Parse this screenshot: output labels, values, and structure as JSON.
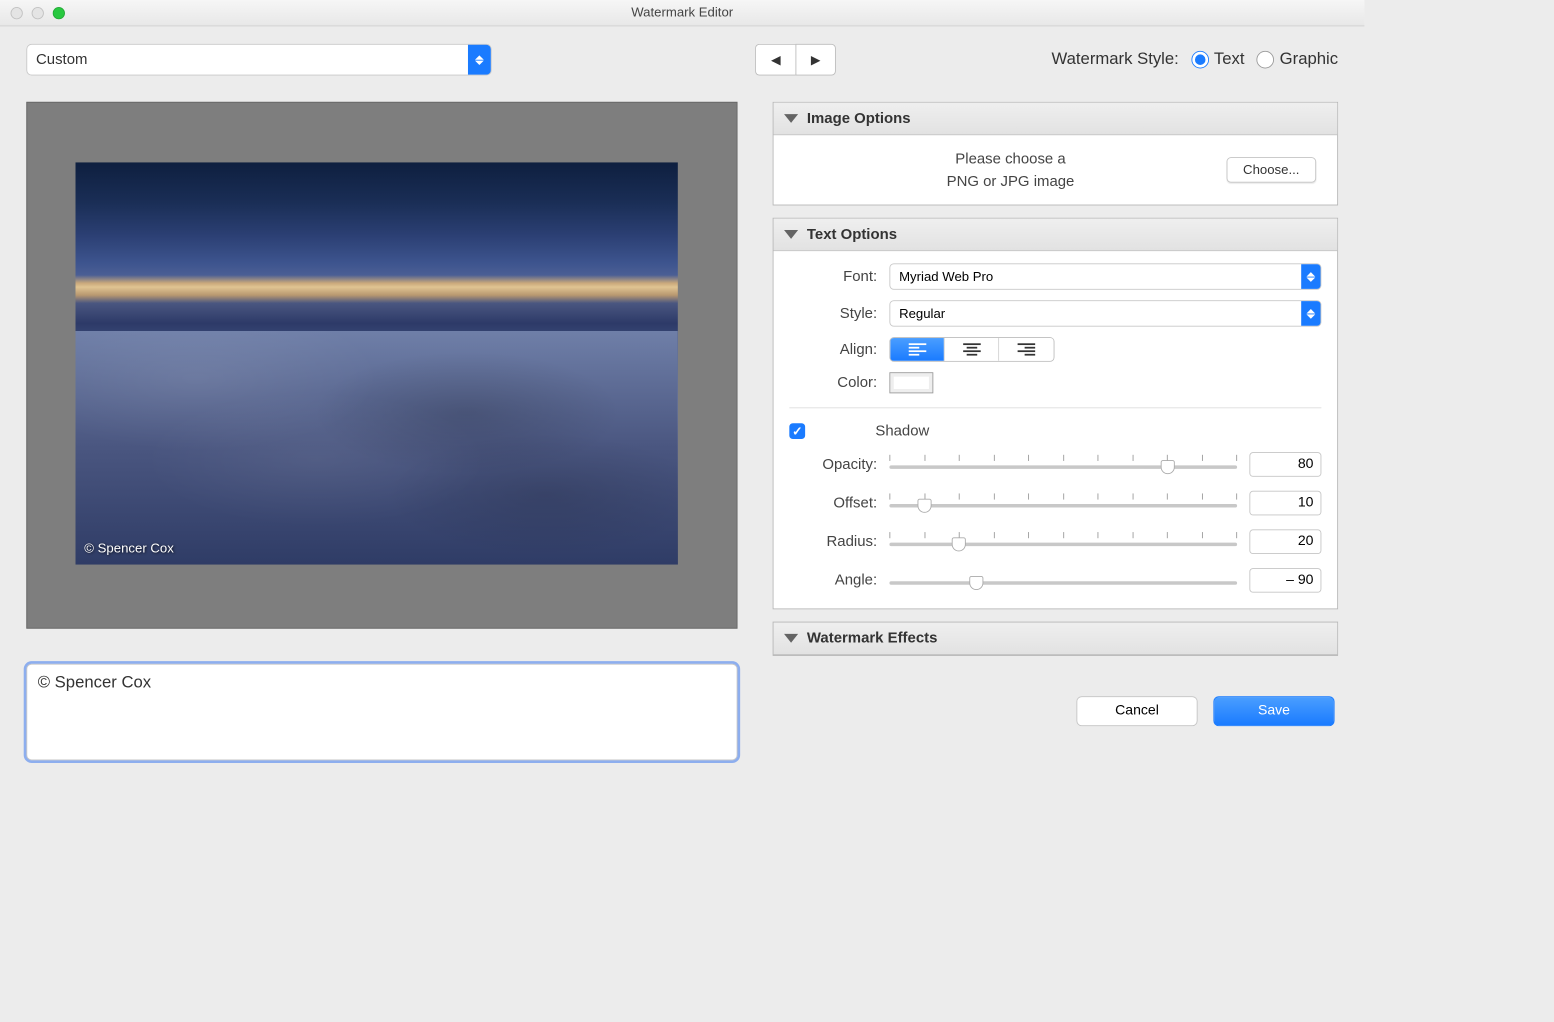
{
  "window": {
    "title": "Watermark Editor"
  },
  "preset": {
    "value": "Custom"
  },
  "style": {
    "label": "Watermark Style:",
    "text": "Text",
    "graphic": "Graphic",
    "selected": "text"
  },
  "preview": {
    "watermark": "© Spencer Cox"
  },
  "watermark_text": "© Spencer Cox",
  "panels": {
    "image": {
      "title": "Image Options",
      "line1": "Please choose a",
      "line2": "PNG or JPG image",
      "choose": "Choose..."
    },
    "text": {
      "title": "Text Options",
      "font_label": "Font:",
      "font_value": "Myriad Web Pro",
      "style_label": "Style:",
      "style_value": "Regular",
      "align_label": "Align:",
      "color_label": "Color:",
      "shadow": {
        "label": "Shadow",
        "checked": true,
        "opacity_label": "Opacity:",
        "opacity": "80",
        "offset_label": "Offset:",
        "offset": "10",
        "radius_label": "Radius:",
        "radius": "20",
        "angle_label": "Angle:",
        "angle": "– 90"
      }
    },
    "effects": {
      "title": "Watermark Effects"
    }
  },
  "footer": {
    "cancel": "Cancel",
    "save": "Save"
  }
}
